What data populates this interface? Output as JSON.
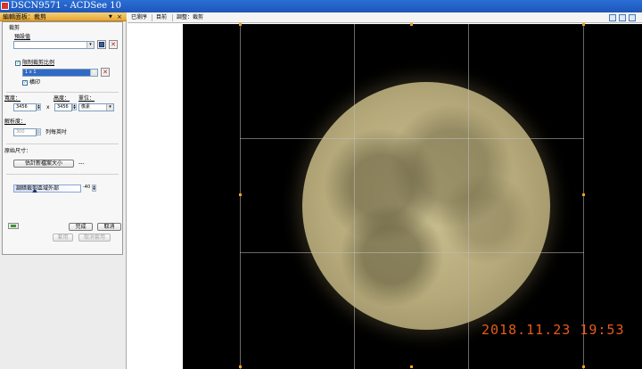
{
  "window": {
    "title": "DSCN9571 - ACDSee 10",
    "icon": "acdsee-app-icon"
  },
  "panel": {
    "title": "編輯面板：裁剪",
    "dropdown_glyph": "▼",
    "close_glyph": "×",
    "section_crop": "裁剪",
    "preset_label": "預設值",
    "preset_value": "",
    "lock_ratio_label": "限制裁剪比例",
    "ratio_value": "1 x 1",
    "landscape_label": "橫印",
    "width_label": "寬度：",
    "height_label": "高度：",
    "unit_label": "單位：",
    "width_value": "3456",
    "height_value": "3456",
    "times_sign": "x",
    "unit_value": "像素",
    "resolution_label": "解析度：",
    "resolution_value": "300",
    "resolution_unit": "列每英吋",
    "original_size_label": "原始尺寸：",
    "estimate_button": "估計新檔案大小",
    "estimate_result": "---",
    "darken_label": "調暗裁剪區域外部",
    "darken_value": "-40",
    "darken_level": 0.3,
    "done_button": "完成",
    "cancel_button": "取消",
    "apply_button": "套用",
    "undo_button": "取消套用",
    "check_glyph": "✓",
    "arrow_glyph": "▾",
    "spin_up": "▲",
    "spin_down": "▼",
    "close_x": "✕"
  },
  "tabs": [
    "已瀏序",
    "目前",
    "調整：裁剪"
  ],
  "image": {
    "date_stamp": "2018.11.23  19:53"
  },
  "colors": {
    "title_bar": "#1f55b8",
    "panel_header": "#e8a632",
    "date_stamp": "#e85a1a",
    "crop_handle": "#f0a020"
  }
}
